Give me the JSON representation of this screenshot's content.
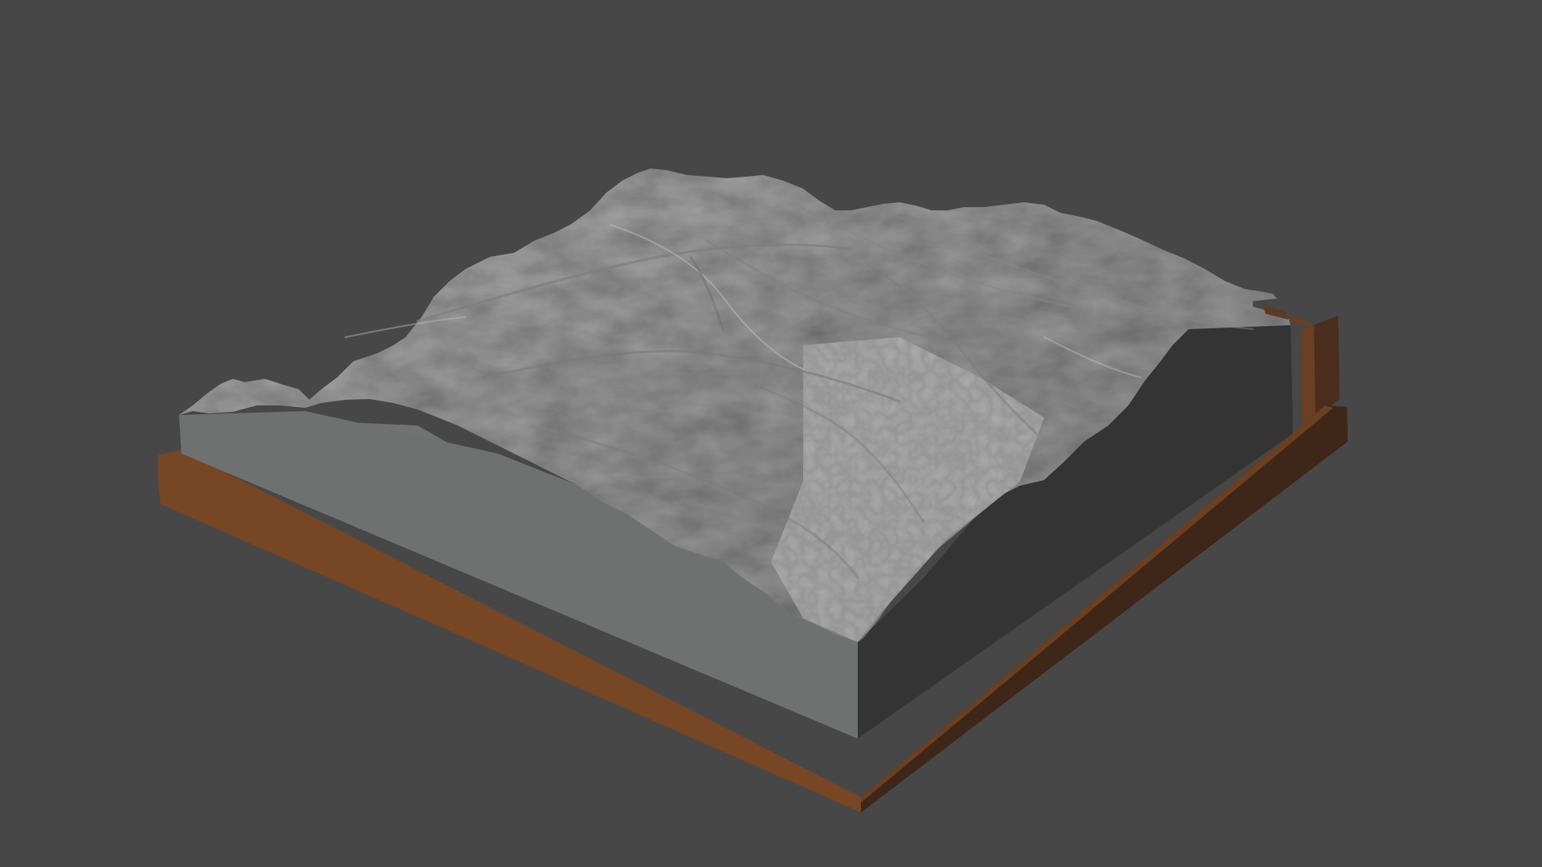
{
  "scene": {
    "subject": "terrain-relief-model",
    "colors": {
      "background": "#474747",
      "terrain_light": "#a9a9a9",
      "terrain_mid": "#8e8e8e",
      "terrain_shadow": "#6f6f6f",
      "front_face": "#6e6f6f",
      "right_face": "#353535",
      "base_front": "#774625",
      "base_top": "#6b3f22",
      "base_right": "#3f2619"
    }
  }
}
